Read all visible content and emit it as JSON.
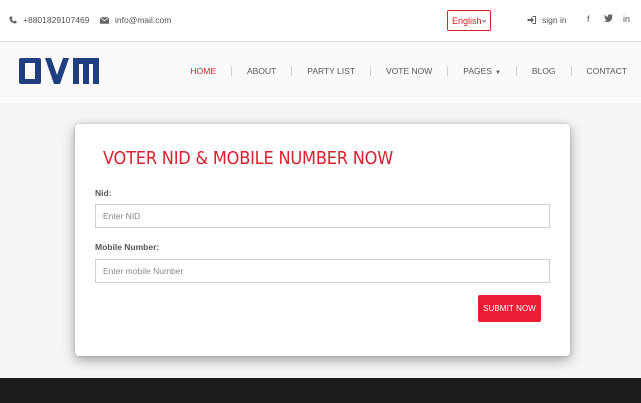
{
  "topbar": {
    "phone": "+8801829107469",
    "email": "info@mail.com",
    "language": "English",
    "signin": "sign in",
    "social": [
      "f",
      "t",
      "in"
    ]
  },
  "logo": {
    "text": "OVM"
  },
  "nav": {
    "items": [
      {
        "label": "HOME",
        "active": true
      },
      {
        "label": "ABOUT"
      },
      {
        "label": "PARTY LIST"
      },
      {
        "label": "VOTE NOW"
      },
      {
        "label": "PAGES"
      },
      {
        "label": "BLOG"
      },
      {
        "label": "CONTACT"
      }
    ]
  },
  "form": {
    "title": "VOTER NID & MOBILE NUMBER NOW",
    "nid_label": "Nid:",
    "nid_placeholder": "Enter NID",
    "mobile_label": "Mobile Number:",
    "mobile_placeholder": "Enter mobile Number",
    "submit_label": "SUBMIT NOW"
  },
  "colors": {
    "accent": "#d9202e",
    "button": "#ec1c35",
    "logo": "#1f3f80",
    "footer": "#1c1c1c"
  }
}
